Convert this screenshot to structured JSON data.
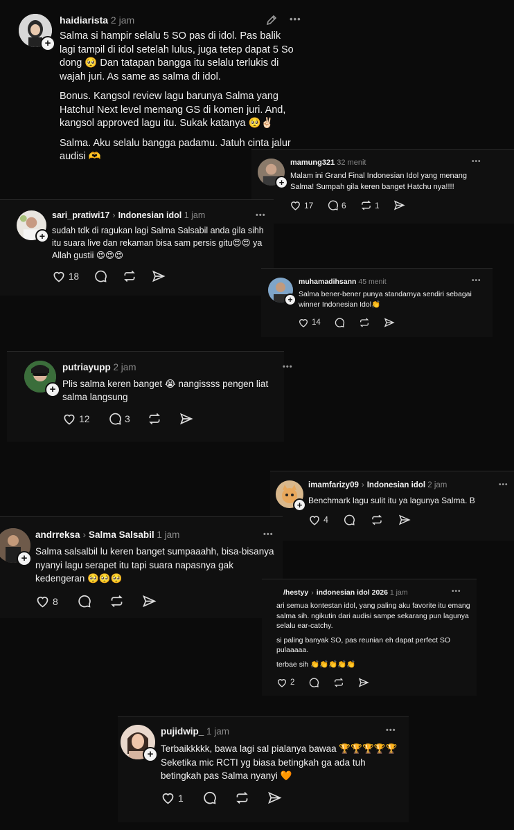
{
  "posts": [
    {
      "user": "haidiarista",
      "time": "2 jam",
      "paragraphs": [
        "Salma si hampir selalu 5 SO pas di idol. Pas balik lagi tampil di idol setelah lulus, juga tetep dapat 5 So dong 🥺 Dan tatapan bangga itu selalu terlukis di wajah juri. As same as salma di idol.",
        "Bonus. Kangsol review lagu barunya Salma yang Hatchu! Next level memang GS di komen juri. And, kangsol approved lagu itu. Sukak katanya 🥺✌🏻",
        "Salma. Aku selalu bangga padamu. Jatuh cinta jalur audisi 🫶"
      ]
    },
    {
      "user": "mamung321",
      "time": "32 menit",
      "text": "Malam ini Grand Final Indonesian Idol yang menang Salma! Sumpah gila keren banget Hatchu nya!!!!",
      "likes": "17",
      "replies": "6",
      "reposts": "1"
    },
    {
      "user": "sari_pratiwi17",
      "topic": "Indonesian idol",
      "time": "1 jam",
      "text": "sudah tdk di ragukan lagi Salma Salsabil anda gila sihh itu suara live dan rekaman bisa sam persis gitu😍😍 ya  Allah gustii 😍😍😍",
      "likes": "18"
    },
    {
      "user": "muhamadihsann",
      "time": "45 menit",
      "text": "Salma bener-bener punya standarnya sendiri sebagai winner Indonesian Idol👏",
      "likes": "14"
    },
    {
      "user": "putriayupp",
      "time": "2 jam",
      "text": "Plis salma keren banget 😭 nangissss pengen liat salma langsung",
      "likes": "12",
      "replies": "3"
    },
    {
      "user": "imamfarizy09",
      "topic": "Indonesian idol",
      "time": "2 jam",
      "text": "Benchmark lagu sulit itu ya lagunya Salma. B",
      "likes": "4"
    },
    {
      "user": "andrreksa",
      "topic": "Salma Salsabil",
      "time": "1 jam",
      "text": "Salma salsalbil lu keren banget sumpaaahh, bisa-bisanya nyanyi lagu serapet itu tapi suara napasnya gak kedengeran 🥺🥺🥺",
      "likes": "8"
    },
    {
      "user": "/hestyy",
      "topic": "indonesian idol 2026",
      "time": "1 jam",
      "paragraphs": [
        "ari semua kontestan idol, yang paling aku favorite itu emang salma sih. ngikutin dari audisi sampe sekarang pun lagunya selalu ear-catchy.",
        "si paling banyak SO, pas reunian eh dapat perfect SO pulaaaaa.",
        "terbae sih 👏👏👏👏👏"
      ],
      "likes": "2"
    },
    {
      "user": "pujidwip_",
      "time": "1 jam",
      "text": "Terbaikkkkk, bawa lagi sal pialanya bawaa 🏆🏆🏆🏆🏆 Seketika mic RCTI yg biasa betingkah ga ada tuh betingkah pas Salma nyanyi 🧡",
      "likes": "1"
    }
  ],
  "icons": {
    "like": "heart-icon",
    "reply": "comment-icon",
    "repost": "repost-icon",
    "share": "send-icon",
    "edit": "pencil-icon",
    "more": "more-icon",
    "follow": "plus-icon"
  },
  "more_glyph": "•••",
  "plus_glyph": "+",
  "chevron_glyph": "›"
}
